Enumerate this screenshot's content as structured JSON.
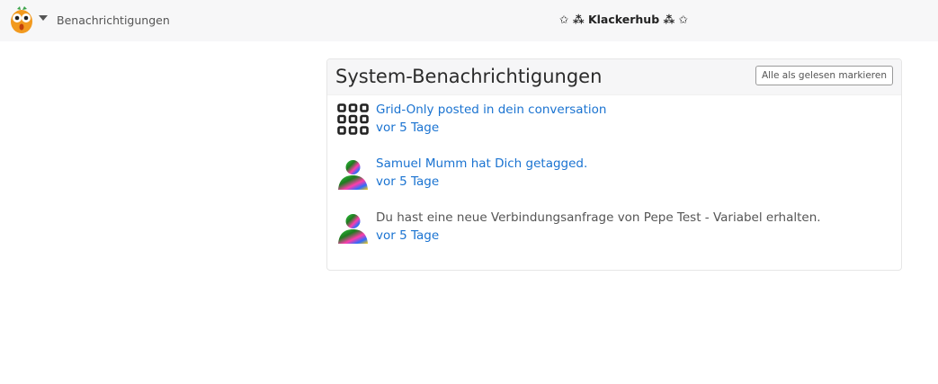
{
  "header": {
    "page_label": "Benachrichtigungen",
    "site_title": "✩ ⁂ Klackerhub ⁂ ✩",
    "logo_icon": "owl-logo-icon",
    "menu_icon": "caret-down-icon"
  },
  "panel": {
    "title": "System-Benachrichtigungen",
    "mark_all_label": "Alle als gelesen markieren"
  },
  "notifications": [
    {
      "text": "Grid-Only posted in dein conversation",
      "time": "vor 5 Tage",
      "avatar": "grid-avatar-icon",
      "text_is_link": true
    },
    {
      "text": "Samuel Mumm hat Dich getagged.",
      "time": "vor 5 Tage",
      "avatar": "user-avatar",
      "text_is_link": true
    },
    {
      "text": "Du hast eine neue Verbindungsanfrage von Pepe Test - Variabel erhalten.",
      "time": "vor 5 Tage",
      "avatar": "user-avatar",
      "text_is_link": false
    }
  ],
  "colors": {
    "link": "#1a73d1",
    "topbar": "#f7f7f8",
    "panel_header": "#f6f6f7"
  }
}
